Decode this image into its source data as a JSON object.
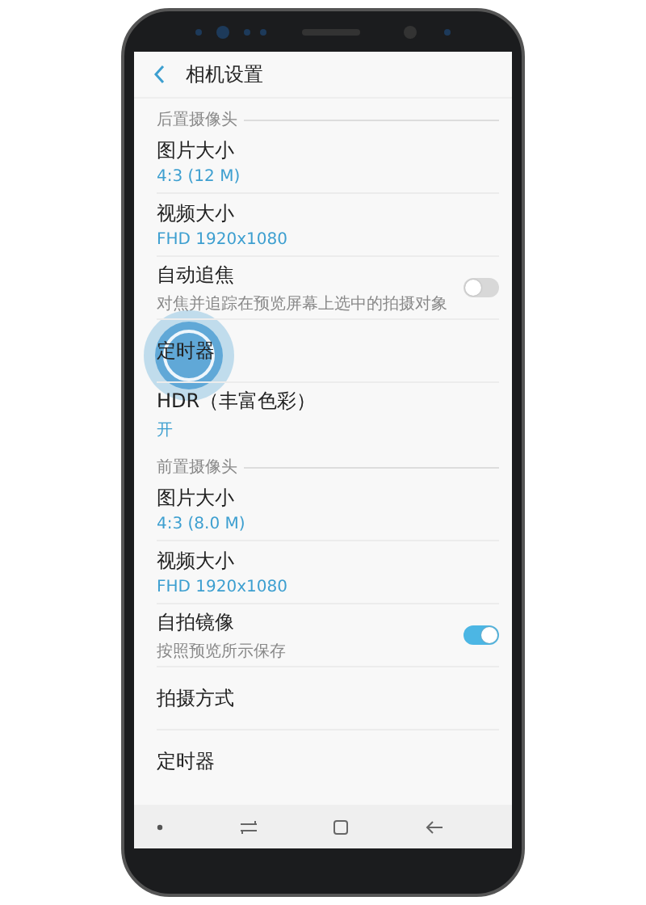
{
  "header": {
    "title": "相机设置"
  },
  "sections": [
    {
      "title": "后置摄像头",
      "items": [
        {
          "kind": "value",
          "title": "图片大小",
          "value": "4:3 (12 M)"
        },
        {
          "kind": "value",
          "title": "视频大小",
          "value": "FHD 1920x1080"
        },
        {
          "kind": "toggle",
          "title": "自动追焦",
          "subtitle": "对焦并追踪在预览屏幕上选中的拍摄对象",
          "on": false
        },
        {
          "kind": "plain",
          "title": "定时器",
          "pressed": true
        },
        {
          "kind": "value",
          "title": "HDR（丰富色彩）",
          "value": "开"
        }
      ]
    },
    {
      "title": "前置摄像头",
      "items": [
        {
          "kind": "value",
          "title": "图片大小",
          "value": "4:3 (8.0 M)"
        },
        {
          "kind": "value",
          "title": "视频大小",
          "value": "FHD 1920x1080"
        },
        {
          "kind": "toggle",
          "title": "自拍镜像",
          "subtitle": "按照预览所示保存",
          "on": true
        },
        {
          "kind": "plain",
          "title": "拍摄方式"
        },
        {
          "kind": "plain",
          "title": "定时器"
        }
      ]
    }
  ]
}
